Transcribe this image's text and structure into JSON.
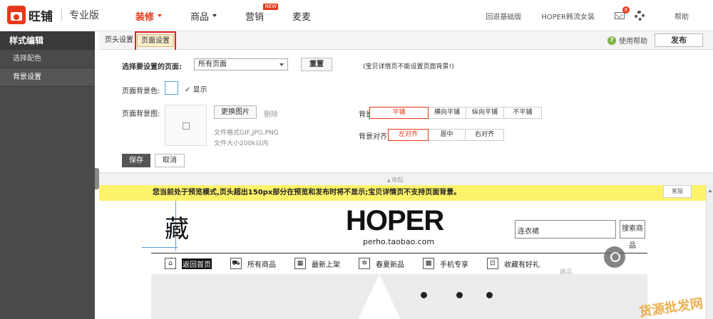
{
  "header": {
    "logo_text": "旺铺",
    "edition": "专业版",
    "nav": [
      {
        "label": "装修",
        "active": true
      },
      {
        "label": "商品"
      },
      {
        "label": "营销",
        "badge": "NEW"
      },
      {
        "label": "麦麦"
      }
    ],
    "right_links": [
      "回退基础版",
      "HOPER韩流女装"
    ],
    "mail_count": "8",
    "help": "帮助"
  },
  "sidebar": {
    "title": "样式编辑",
    "items": [
      {
        "label": "选择配色"
      },
      {
        "label": "背景设置",
        "selected": true
      }
    ]
  },
  "subtabs": [
    "页头设置",
    "页面设置"
  ],
  "toolbar": {
    "help": "使用帮助",
    "publish": "发布"
  },
  "form": {
    "page_label": "选择要设置的页面:",
    "page_value": "所有页面",
    "reset": "重置",
    "note": "(宝贝详情页不能设置页面背景!)",
    "bgcolor_label": "页面背景色:",
    "show_label": "显示",
    "bgimage_label": "页面背景图:",
    "change_image": "更换图片",
    "delete": "删除",
    "format_hint": "文件格式GIF,JPG,PNG",
    "size_hint": "文件大小200k以内",
    "display_label": "背景显示:",
    "display_options": [
      "平铺",
      "横向平铺",
      "纵向平铺",
      "不平铺"
    ],
    "display_selected": "平铺",
    "align_label": "背景对齐:",
    "align_options": [
      "左对齐",
      "居中",
      "右对齐"
    ],
    "align_selected": "左对齐",
    "save": "保存",
    "cancel": "取消"
  },
  "preview": {
    "fold": "收起",
    "banner": "您当前处于预览模式,页头超出150px部分在预览和发布时将不显示;宝贝详情页不支持页面背景。",
    "service": "客服",
    "shop": {
      "char": "藏",
      "brand": "HOPER",
      "domain": "perho.taobao.com",
      "search_value": "连衣裙",
      "search_button": "搜索商品",
      "nav": [
        "返回首页",
        "所有商品",
        "最新上架",
        "春夏新品",
        "手机专享",
        "收藏有好礼"
      ],
      "faint_text": "商品"
    }
  },
  "watermark": "货源批发网"
}
